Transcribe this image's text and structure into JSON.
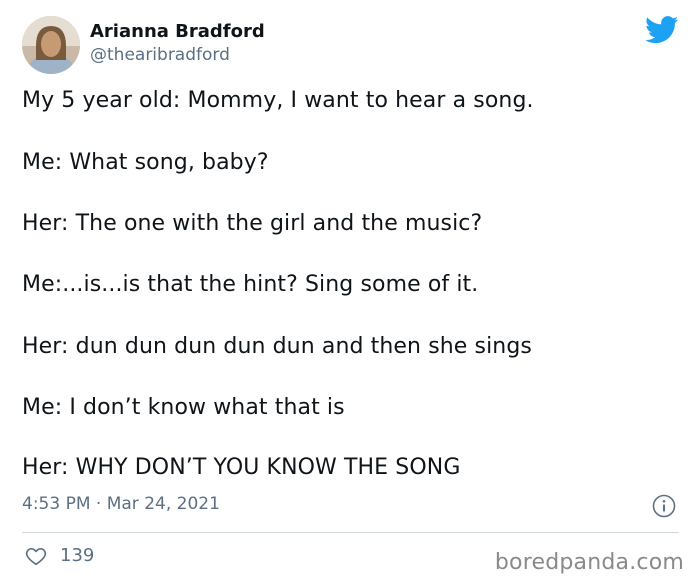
{
  "author": {
    "name": "Arianna Bradford",
    "handle": "@thearibradford"
  },
  "tweet": {
    "lines": [
      "My 5 year old: Mommy, I want to hear a song.",
      "Me: What song, baby?",
      "Her: The one with the girl and the music?",
      "Me:...is...is that the hint? Sing some of it.",
      "Her: dun dun dun dun dun and then she sings",
      "Me: I don’t know what that is",
      "Her: WHY DON’T YOU KNOW THE SONG"
    ],
    "timestamp": "4:53 PM · Mar 24, 2021",
    "likes": "139"
  },
  "watermark": "boredpanda.com",
  "icons": {
    "brand": "twitter-bird-icon",
    "info": "info-icon",
    "like": "heart-icon"
  },
  "colors": {
    "twitter_blue": "#1da1f2",
    "secondary_text": "#5b7083",
    "divider": "#cfd9de"
  }
}
